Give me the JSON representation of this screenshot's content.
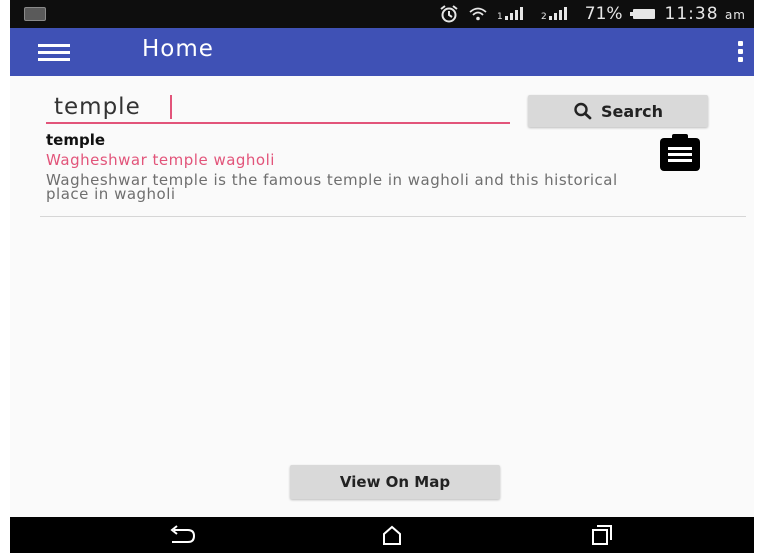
{
  "status_bar": {
    "battery_percent": "71%",
    "time": "11:38",
    "am_pm": "am"
  },
  "app_bar": {
    "title": "Home"
  },
  "search": {
    "value": "temple",
    "button_label": "Search"
  },
  "results": [
    {
      "category": "temple",
      "title": "Wagheshwar temple wagholi",
      "description": "Wagheshwar temple is the famous temple in  wagholi and this historical place in wagholi"
    }
  ],
  "view_map_label": "View On Map",
  "colors": {
    "app_bar": "#3f51b5",
    "accent": "#e2547a"
  }
}
